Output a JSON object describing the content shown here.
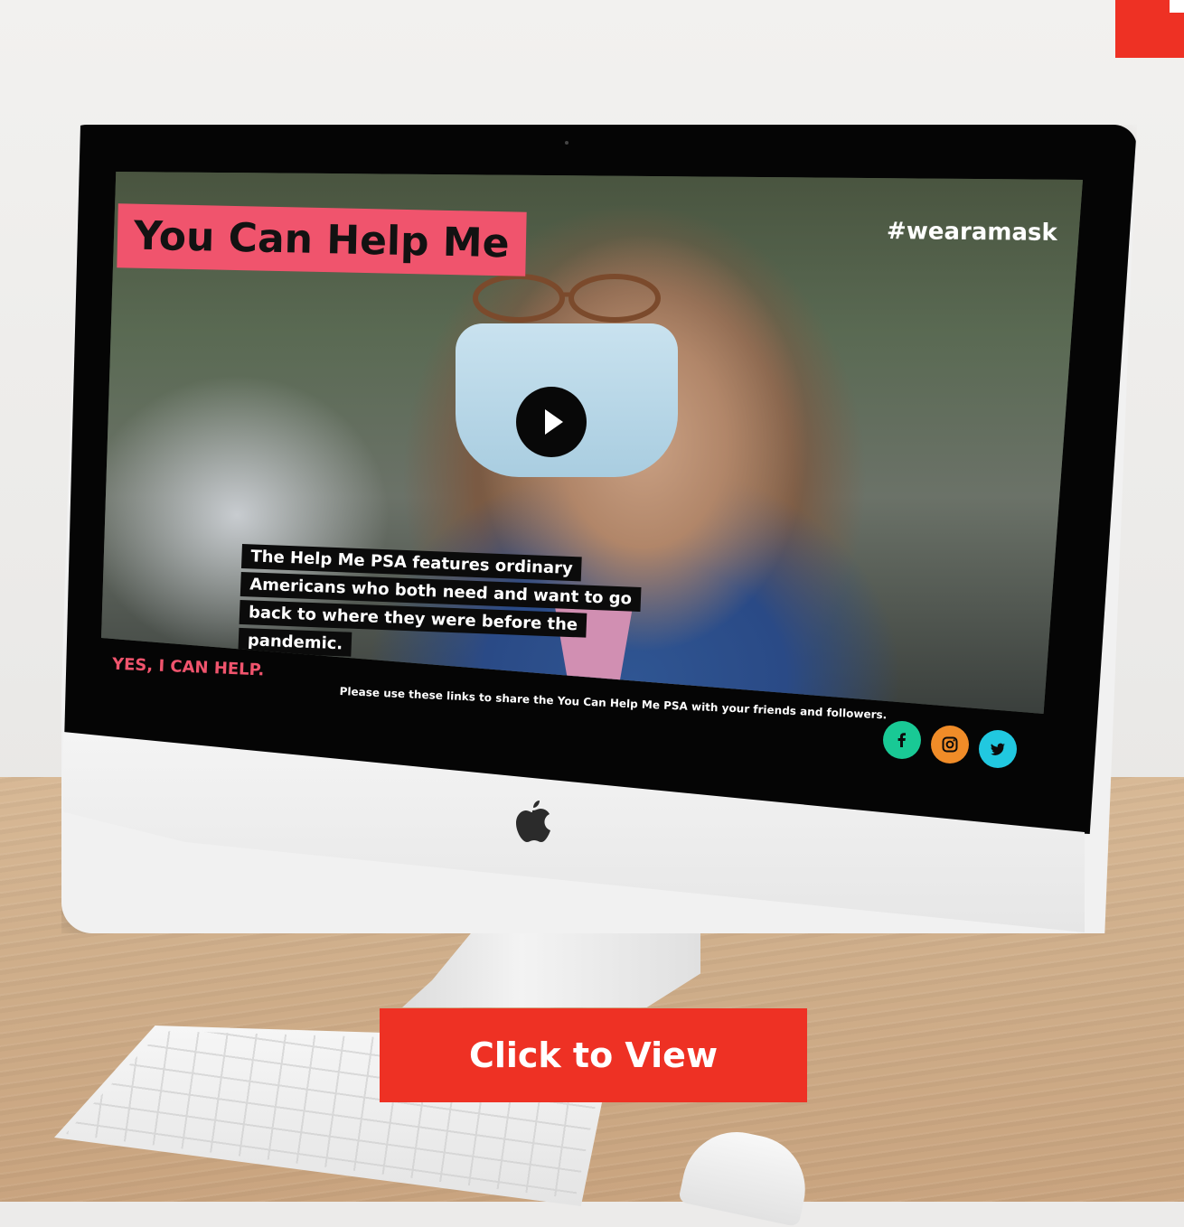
{
  "video": {
    "title": "You Can Help Me",
    "hashtag": "#wearamask",
    "caption_lines": [
      "The Help Me PSA features ordinary",
      "Americans who both need and want to go",
      "back to where they were before the",
      "pandemic."
    ],
    "tagline": "YES, I CAN HELP.",
    "share_text": "Please use these links to share the You Can Help Me PSA with your friends and followers."
  },
  "social": [
    {
      "name": "facebook-icon",
      "color": "#19c995"
    },
    {
      "name": "instagram-icon",
      "color": "#f08c28"
    },
    {
      "name": "twitter-icon",
      "color": "#21c8e0"
    }
  ],
  "cta": {
    "label": "Click to View",
    "color": "#ee3124"
  },
  "colors": {
    "accent_pink": "#f0546d",
    "brand_red": "#ee3124"
  }
}
